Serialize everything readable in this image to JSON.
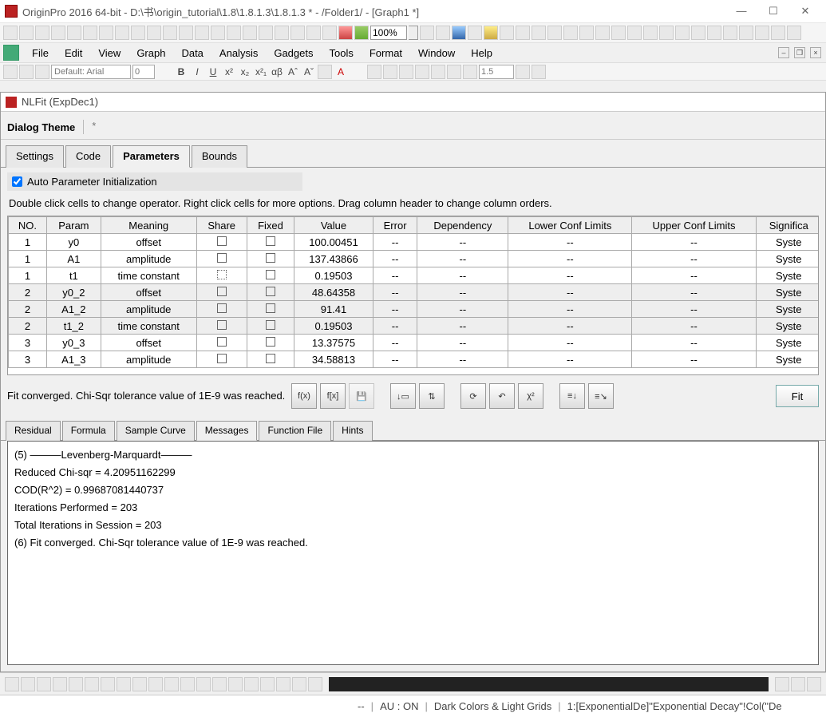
{
  "window": {
    "title": "OriginPro 2016 64-bit - D:\\书\\origin_tutorial\\1.8\\1.8.1.3\\1.8.1.3 * - /Folder1/ - [Graph1 *]",
    "minimize": "—",
    "maximize": "☐",
    "close": "✕"
  },
  "zoom": "100%",
  "menus": [
    "File",
    "Edit",
    "View",
    "Graph",
    "Data",
    "Analysis",
    "Gadgets",
    "Tools",
    "Format",
    "Window",
    "Help"
  ],
  "fmt": {
    "font": "Default: Arial",
    "size": "0",
    "lineweight": "1.5"
  },
  "dialog": {
    "title": "NLFit (ExpDec1)",
    "theme_label": "Dialog Theme",
    "theme_star": "*",
    "tabs": [
      "Settings",
      "Code",
      "Parameters",
      "Bounds"
    ],
    "active_tab": 2,
    "auto_init_label": "Auto Parameter Initialization",
    "help_text": "Double click cells to change operator. Right click cells for more options. Drag column header to change column orders.",
    "headers": [
      "NO.",
      "Param",
      "Meaning",
      "Share",
      "Fixed",
      "Value",
      "Error",
      "Dependency",
      "Lower Conf Limits",
      "Upper Conf Limits",
      "Significa"
    ],
    "rows": [
      {
        "no": "1",
        "param": "y0",
        "meaning": "offset",
        "value": "100.00451",
        "error": "--",
        "dep": "--",
        "lcl": "--",
        "ucl": "--",
        "sig": "Syste",
        "stripe": false,
        "dotted": false
      },
      {
        "no": "1",
        "param": "A1",
        "meaning": "amplitude",
        "value": "137.43866",
        "error": "--",
        "dep": "--",
        "lcl": "--",
        "ucl": "--",
        "sig": "Syste",
        "stripe": false,
        "dotted": false
      },
      {
        "no": "1",
        "param": "t1",
        "meaning": "time constant",
        "value": "0.19503",
        "error": "--",
        "dep": "--",
        "lcl": "--",
        "ucl": "--",
        "sig": "Syste",
        "stripe": false,
        "dotted": true
      },
      {
        "no": "2",
        "param": "y0_2",
        "meaning": "offset",
        "value": "48.64358",
        "error": "--",
        "dep": "--",
        "lcl": "--",
        "ucl": "--",
        "sig": "Syste",
        "stripe": true,
        "dotted": false
      },
      {
        "no": "2",
        "param": "A1_2",
        "meaning": "amplitude",
        "value": "91.41",
        "error": "--",
        "dep": "--",
        "lcl": "--",
        "ucl": "--",
        "sig": "Syste",
        "stripe": true,
        "dotted": false
      },
      {
        "no": "2",
        "param": "t1_2",
        "meaning": "time constant",
        "value": "0.19503",
        "error": "--",
        "dep": "--",
        "lcl": "--",
        "ucl": "--",
        "sig": "Syste",
        "stripe": true,
        "dotted": false
      },
      {
        "no": "3",
        "param": "y0_3",
        "meaning": "offset",
        "value": "13.37575",
        "error": "--",
        "dep": "--",
        "lcl": "--",
        "ucl": "--",
        "sig": "Syste",
        "stripe": false,
        "dotted": false
      },
      {
        "no": "3",
        "param": "A1_3",
        "meaning": "amplitude",
        "value": "34.58813",
        "error": "--",
        "dep": "--",
        "lcl": "--",
        "ucl": "--",
        "sig": "Syste",
        "stripe": false,
        "dotted": false
      }
    ],
    "status": "Fit converged. Chi-Sqr tolerance value of 1E-9 was reached.",
    "action_icons": [
      "f(x)",
      "f[x]",
      "💾",
      "↓▭",
      "⇅",
      "⟳",
      "↶",
      "χ²",
      "≡↓",
      "≡↘"
    ],
    "fit_label": "Fit",
    "msg_tabs": [
      "Residual",
      "Formula",
      "Sample Curve",
      "Messages",
      "Function File",
      "Hints"
    ],
    "msg_active": 3,
    "messages": [
      "(5) ———Levenberg-Marquardt———",
      "Reduced Chi-sqr = 4.20951162299",
      "COD(R^2) = 0.99687081440737",
      "Iterations Performed = 203",
      "Total Iterations in Session = 203",
      "(6) Fit converged. Chi-Sqr tolerance value of 1E-9 was reached."
    ]
  },
  "status": {
    "dash": "--",
    "au": "AU : ON",
    "scheme": "Dark Colors & Light Grids",
    "path": "1:[ExponentialDe]\"Exponential Decay\"!Col(\"De"
  }
}
